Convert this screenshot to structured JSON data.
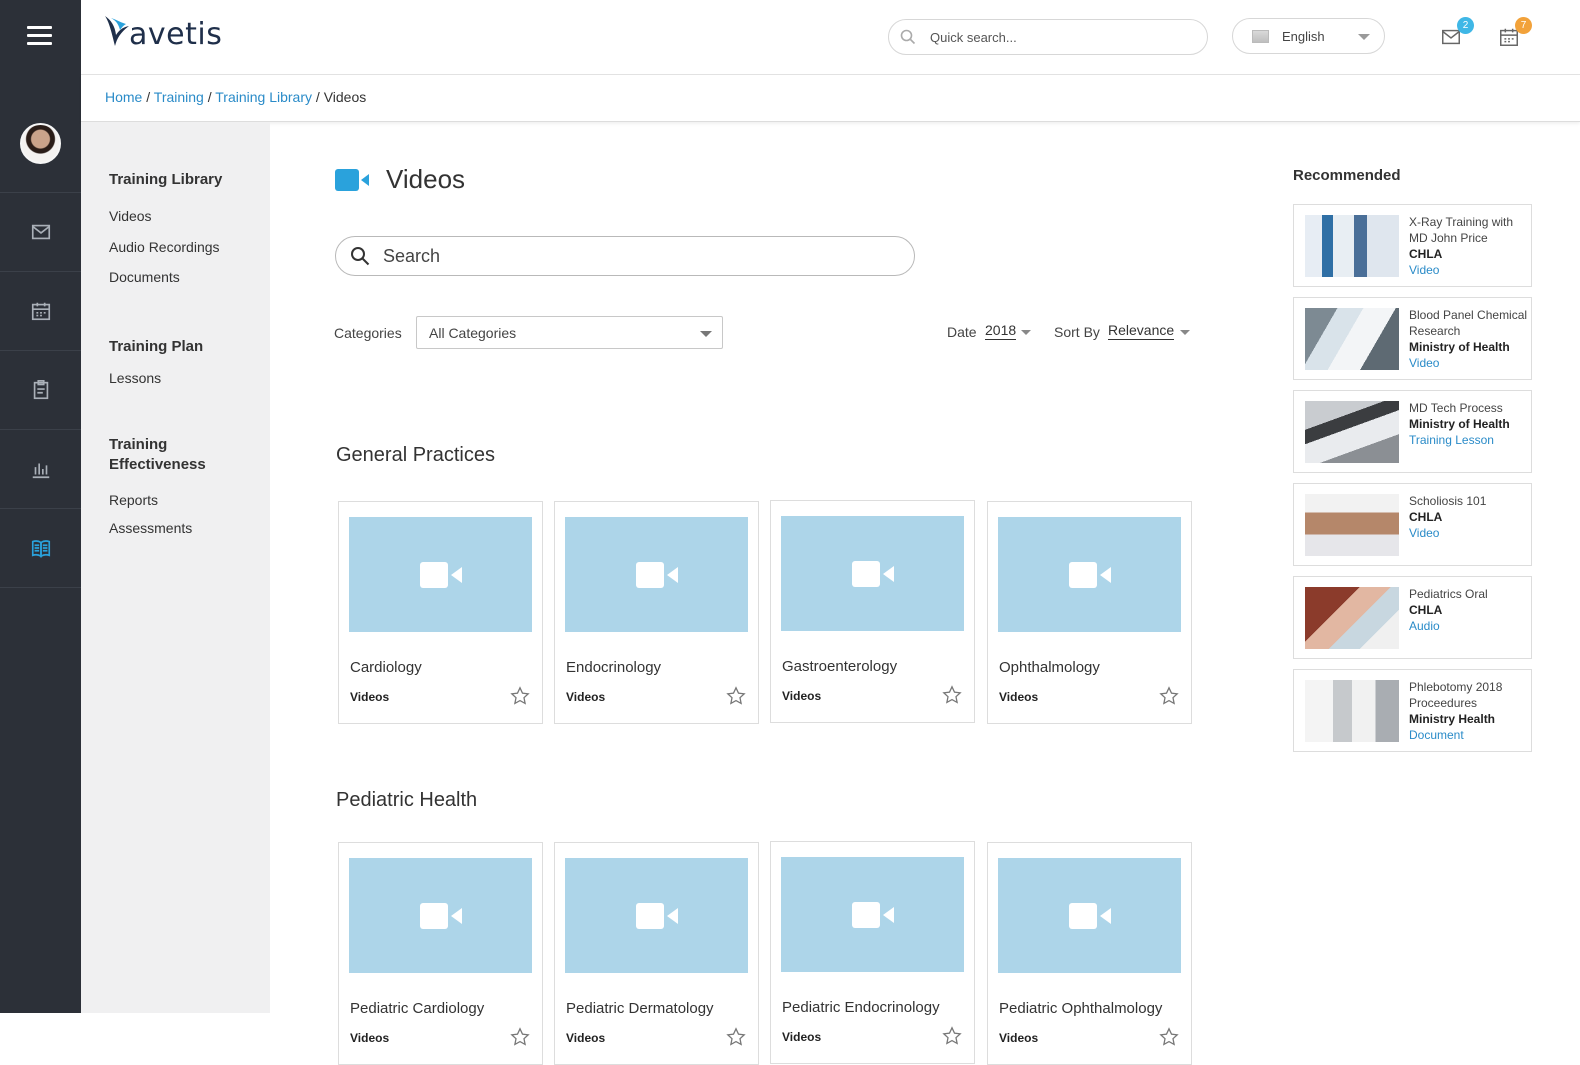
{
  "header": {
    "logo_text": "avetis",
    "search_placeholder": "Quick search...",
    "language": "English",
    "mail_count": "2",
    "calendar_count": "7"
  },
  "breadcrumb": [
    "Home",
    "Training",
    "Training Library",
    "Videos"
  ],
  "sidebar": {
    "sections": [
      {
        "title": "Training Library",
        "links": [
          "Videos",
          "Audio Recordings",
          "Documents"
        ]
      },
      {
        "title": "Training Plan",
        "links": [
          "Lessons"
        ]
      },
      {
        "title": "Training Effectiveness",
        "links": [
          "Reports",
          "Assessments"
        ]
      }
    ]
  },
  "rail_icons": [
    "menu-icon",
    "mail-icon",
    "calendar-icon",
    "clipboard-icon",
    "chart-icon",
    "book-icon"
  ],
  "main": {
    "title": "Videos",
    "search_placeholder": "Search",
    "categories_label": "Categories",
    "categories_value": "All Categories",
    "date_label": "Date",
    "date_value": "2018",
    "sort_label": "Sort By",
    "sort_value": "Relevance",
    "groups": [
      {
        "title": "General Practices",
        "cards": [
          {
            "title": "Cardiology",
            "type": "Videos"
          },
          {
            "title": "Endocrinology",
            "type": "Videos"
          },
          {
            "title": "Gastroenterology",
            "type": "Videos"
          },
          {
            "title": "Ophthalmology",
            "type": "Videos"
          }
        ]
      },
      {
        "title": "Pediatric Health",
        "cards": [
          {
            "title": "Pediatric Cardiology",
            "type": "Videos"
          },
          {
            "title": "Pediatric Dermatology",
            "type": "Videos"
          },
          {
            "title": "Pediatric Endocrinology",
            "type": "Videos"
          },
          {
            "title": "Pediatric Ophthalmology",
            "type": "Videos"
          }
        ]
      }
    ]
  },
  "recommended": {
    "title": "Recommended",
    "items": [
      {
        "name": "X-Ray Training with MD John Price",
        "org": "CHLA",
        "kind": "Video"
      },
      {
        "name": "Blood Panel Chemical Research",
        "org": "Ministry of Health",
        "kind": "Video"
      },
      {
        "name": "MD Tech Process",
        "org": "Ministry of Health",
        "kind": "Training Lesson"
      },
      {
        "name": "Scholiosis 101",
        "org": "CHLA",
        "kind": "Video"
      },
      {
        "name": "Pediatrics Oral",
        "org": "CHLA",
        "kind": "Audio"
      },
      {
        "name": "Phlebotomy 2018 Proceedures",
        "org": "Ministry Health",
        "kind": "Document"
      }
    ]
  },
  "colors": {
    "rail": "#2c3038",
    "accent": "#2aa2dc",
    "link": "#2a8bc8",
    "thumb": "#add5e9",
    "mail_badge": "#3fb7e6",
    "calendar_badge": "#f2a23a"
  }
}
